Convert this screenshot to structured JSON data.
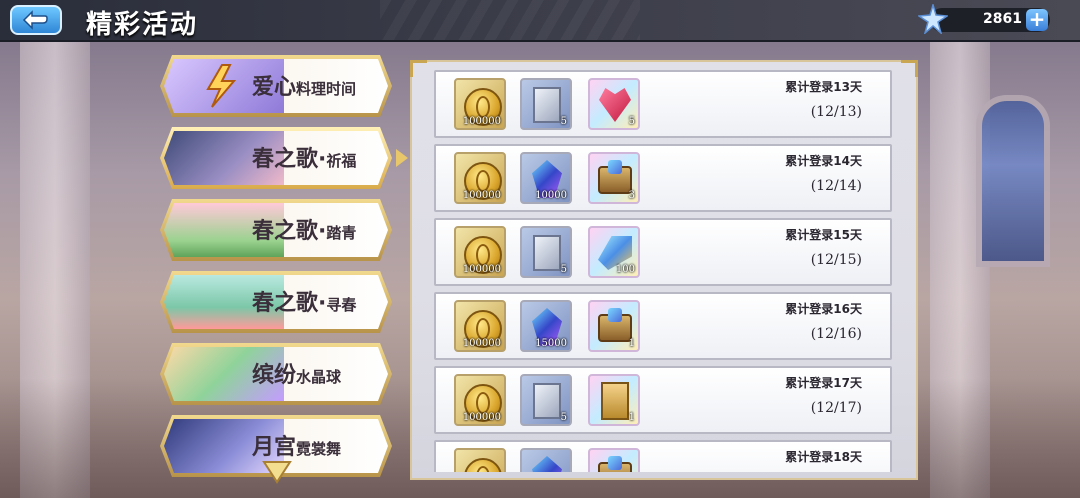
{
  "header": {
    "back_icon": "back-arrow-icon",
    "title": "精彩活动",
    "currency": {
      "icon": "star-crystal-icon",
      "amount": "2861",
      "add_icon": "plus-icon"
    }
  },
  "menu": {
    "items": [
      {
        "main": "爱心",
        "sub": "料理时间",
        "icon": "lightning-icon",
        "active": false
      },
      {
        "main": "春之歌·",
        "sub": "祈福",
        "icon": "lantern-art",
        "active": true
      },
      {
        "main": "春之歌·",
        "sub": "踏青",
        "icon": "meadow-art",
        "active": false
      },
      {
        "main": "春之歌·",
        "sub": "寻春",
        "icon": "flower-art",
        "active": false
      },
      {
        "main": "缤纷",
        "sub": "水晶球",
        "icon": "crystal-ball-art",
        "active": false
      },
      {
        "main": "月宫",
        "sub": "霓裳舞",
        "icon": "moon-palace-art",
        "active": false
      }
    ],
    "scroll_icon": "chevron-down-icon"
  },
  "rewards": {
    "rows": [
      {
        "requirement": "累计登录13天",
        "progress": "(12/13)",
        "items": [
          {
            "icon": "gold-coin-icon",
            "count": "100000"
          },
          {
            "icon": "card-icon",
            "count": "5"
          },
          {
            "icon": "heart-gem-icon",
            "count": "5"
          }
        ]
      },
      {
        "requirement": "累计登录14天",
        "progress": "(12/14)",
        "items": [
          {
            "icon": "gold-coin-icon",
            "count": "100000"
          },
          {
            "icon": "crystal-icon",
            "count": "10000"
          },
          {
            "icon": "treasure-chest-icon",
            "count": "3"
          }
        ]
      },
      {
        "requirement": "累计登录15天",
        "progress": "(12/15)",
        "items": [
          {
            "icon": "gold-coin-icon",
            "count": "100000"
          },
          {
            "icon": "card-icon",
            "count": "5"
          },
          {
            "icon": "magic-wand-icon",
            "count": "100"
          }
        ]
      },
      {
        "requirement": "累计登录16天",
        "progress": "(12/16)",
        "items": [
          {
            "icon": "gold-coin-icon",
            "count": "100000"
          },
          {
            "icon": "crystal-icon",
            "count": "15000"
          },
          {
            "icon": "treasure-chest-icon",
            "count": "1"
          }
        ]
      },
      {
        "requirement": "累计登录17天",
        "progress": "(12/17)",
        "items": [
          {
            "icon": "gold-coin-icon",
            "count": "100000"
          },
          {
            "icon": "card-icon",
            "count": "5"
          },
          {
            "icon": "book-icon",
            "count": "1"
          }
        ]
      },
      {
        "requirement": "累计登录18天",
        "progress": "",
        "items": [
          {
            "icon": "gold-coin-icon",
            "count": ""
          },
          {
            "icon": "crystal-icon",
            "count": ""
          },
          {
            "icon": "treasure-chest-icon",
            "count": ""
          }
        ]
      }
    ]
  }
}
